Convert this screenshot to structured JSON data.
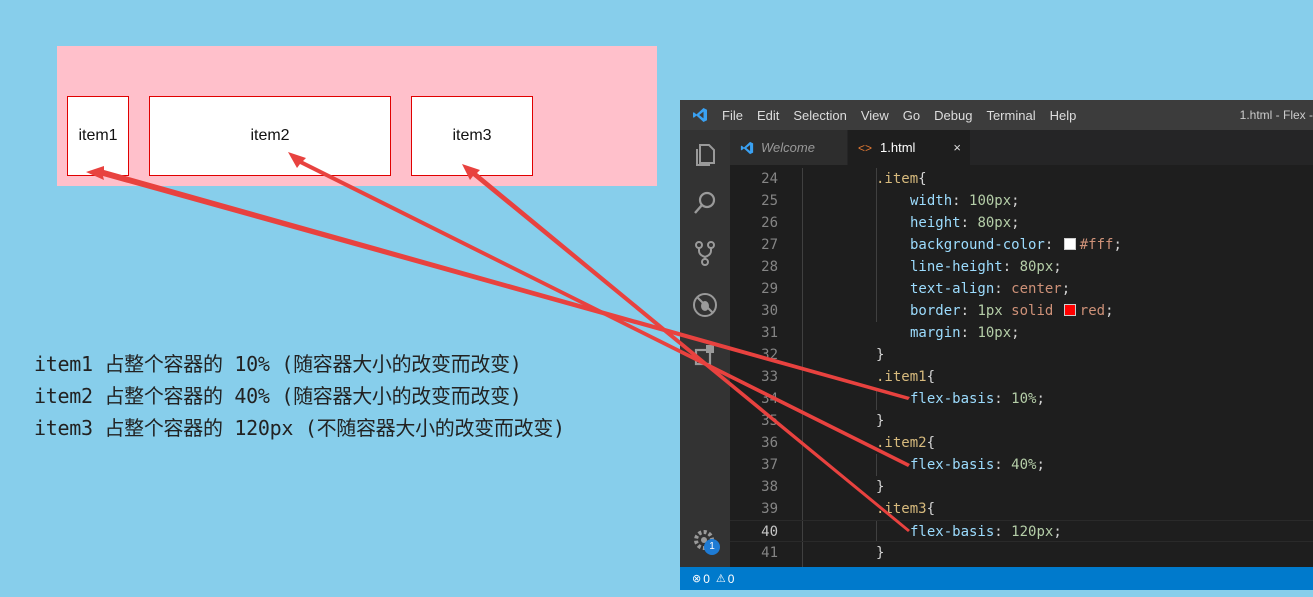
{
  "demo": {
    "items": [
      "item1",
      "item2",
      "item3"
    ]
  },
  "notes": [
    "item1 占整个容器的 10% (随容器大小的改变而改变)",
    "item2 占整个容器的 40% (随容器大小的改变而改变)",
    "item3 占整个容器的 120px (不随容器大小的改变而改变)"
  ],
  "editor": {
    "menu": [
      "File",
      "Edit",
      "Selection",
      "View",
      "Go",
      "Debug",
      "Terminal",
      "Help"
    ],
    "window_title": "1.html - Flex -",
    "tabs": {
      "welcome": "Welcome",
      "file": "1.html",
      "close": "×"
    },
    "code": {
      "l24": {
        "n": "24",
        "sel": ".item",
        "brace": "{"
      },
      "l25": {
        "n": "25",
        "prop": "width",
        "val": "100px"
      },
      "l26": {
        "n": "26",
        "prop": "height",
        "val": "80px"
      },
      "l27": {
        "n": "27",
        "prop": "background-color",
        "val": "#fff",
        "swatch_color": "#ffffff"
      },
      "l28": {
        "n": "28",
        "prop": "line-height",
        "val": "80px"
      },
      "l29": {
        "n": "29",
        "prop": "text-align",
        "val": "center"
      },
      "l30": {
        "n": "30",
        "prop": "border",
        "val1": "1px",
        "val2": "solid",
        "val3": "red",
        "swatch_color": "#ff0000"
      },
      "l31": {
        "n": "31",
        "prop": "margin",
        "val": "10px"
      },
      "l32": {
        "n": "32",
        "brace": "}"
      },
      "l33": {
        "n": "33",
        "sel": ".item1",
        "brace": "{"
      },
      "l34": {
        "n": "34",
        "prop": "flex-basis",
        "val": "10%"
      },
      "l35": {
        "n": "35",
        "brace": "}"
      },
      "l36": {
        "n": "36",
        "sel": ".item2",
        "brace": "{"
      },
      "l37": {
        "n": "37",
        "prop": "flex-basis",
        "val": "40%"
      },
      "l38": {
        "n": "38",
        "brace": "}"
      },
      "l39": {
        "n": "39",
        "sel": ".item3",
        "brace": "{"
      },
      "l40": {
        "n": "40",
        "prop": "flex-basis",
        "val": "120px"
      },
      "l41": {
        "n": "41",
        "brace": "}"
      }
    },
    "status": {
      "errors": "0",
      "warnings": "0"
    },
    "settings_badge": "1"
  },
  "colors": {
    "page_bg": "#87ceeb",
    "container_bg": "#ffc0cb",
    "item_border": "#e00000",
    "annotation_arrow": "#e8423f",
    "status_bar": "#007acc"
  }
}
